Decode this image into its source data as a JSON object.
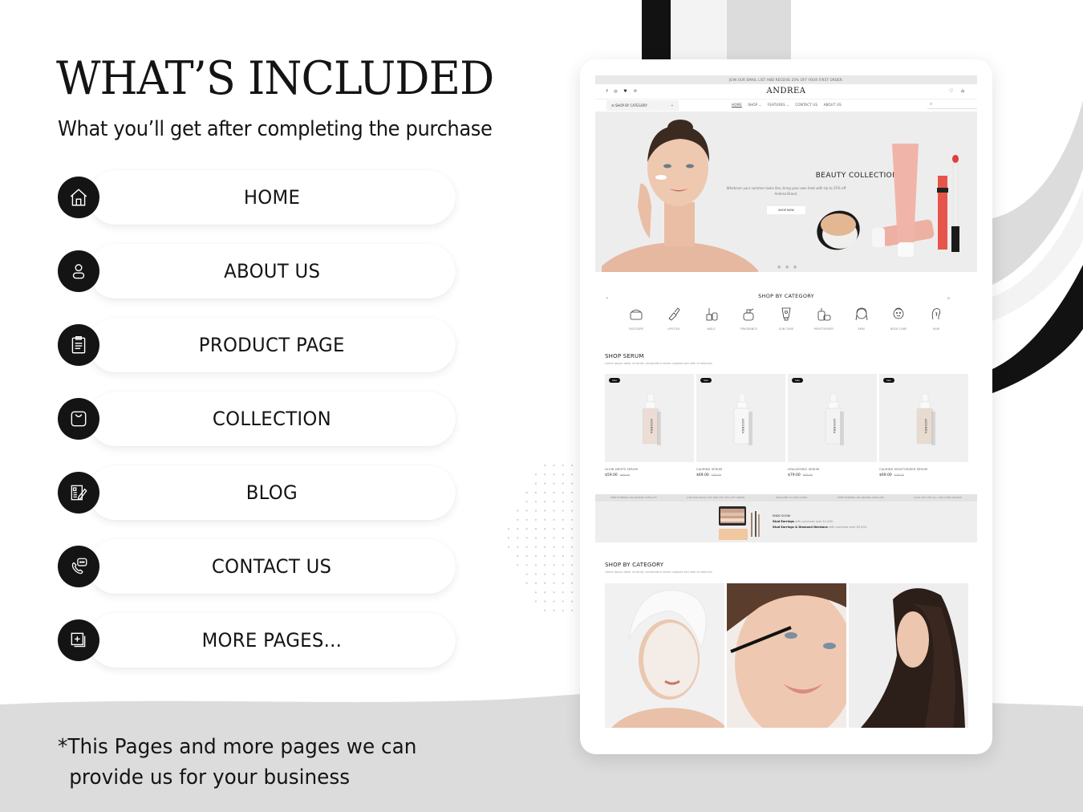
{
  "title": "WHAT’S INCLUDED",
  "subtitle": "What you’ll get after completing the purchase",
  "pages": [
    {
      "label": "HOME",
      "icon": "home-icon"
    },
    {
      "label": "ABOUT US",
      "icon": "user-icon"
    },
    {
      "label": "PRODUCT PAGE",
      "icon": "clipboard-icon"
    },
    {
      "label": "COLLECTION",
      "icon": "shopping-bag-icon"
    },
    {
      "label": "BLOG",
      "icon": "blog-edit-icon"
    },
    {
      "label": "CONTACT US",
      "icon": "phone-chat-icon"
    },
    {
      "label": "MORE PAGES...",
      "icon": "add-pages-icon"
    }
  ],
  "footnote": {
    "line1": "*This Pages and more pages we can",
    "line2": "provide us for your business"
  },
  "mockup": {
    "promo_bar": "JOIN OUR EMAIL LIST AND RECEIVE 20% OFF YOUR FIRST ORDER.",
    "brand": "ANDREA",
    "social_icons": "f ◎ ♥ ℗",
    "header_icons": "♡ ⌂",
    "category_button": "☰  SHOP BY CATEGORY",
    "category_chevron": "⌄",
    "nav_links": [
      "HOME",
      "SHOP ⌄",
      "FEATURES ⌄",
      "CONTACT US",
      "ABOUT US"
    ],
    "search_icon": "⌕",
    "hero": {
      "title": "BEAUTY COLLECTION",
      "description": "Whatever your summer looks like, bring your own heat with Up to 25% off Andrea Brand.",
      "button": "SHOP NOW",
      "slider_dots": "● ● ●"
    },
    "shop_by_category": {
      "title": "SHOP BY CATEGORY",
      "edge_left": "P",
      "edge_right": "M",
      "items": [
        "FACECARE",
        "LIPSTICK",
        "NAILS",
        "FRAGRANCE",
        "SUN CARE",
        "MOISTURIZER",
        "SKIN",
        "BODY CARE",
        "HAIR"
      ]
    },
    "shop_serum": {
      "title": "SHOP SERUM",
      "subtitle": "Lorem ipsum dolor sit amet, consectetur donec sodales sed nibh id vehicula.",
      "products": [
        {
          "badge": "Sale",
          "name": "GLOW DROPS SERUM",
          "price": "$59.00",
          "old_price": "$69.00",
          "tint": "#ecdcd6"
        },
        {
          "badge": "Sale",
          "name": "CALMING SERUM",
          "price": "$69.00",
          "old_price": "$79.00",
          "tint": "#f7f7f7"
        },
        {
          "badge": "Sale",
          "name": "HYALURONIC SERUM",
          "price": "$79.00",
          "old_price": "$89.00",
          "tint": "#f3f3f3"
        },
        {
          "badge": "Sale",
          "name": "CALMING MOISTURIZER SERUM",
          "price": "$69.00",
          "old_price": "$79.00",
          "tint": "#e8dcd0"
        }
      ]
    },
    "ticker": [
      "FREE SHIPPING ON ORDERS OVER £75",
      "JOIN OUR EMAIL LIST AND GET 20% OFF ORDER.",
      "WELCOME TO OUR STORE",
      "FREE SHIPPING ON ORDERS OVER £85",
      "SALE 25% OFF ALL, USE CODE ORANGE"
    ],
    "offer": {
      "heading": "ENDS SOON!",
      "line1_bold": "Stud Earrings",
      "line1_rest": " with purchase over $1,000.",
      "line2_bold": "Stud Earrings & Diamond Necklace",
      "line2_rest": " with purchase over $3,000."
    },
    "shop_by_category_2": {
      "title": "SHOP BY CATEGORY",
      "subtitle": "Lorem ipsum dolor sit amet, consectetur donec sodales sed nibh id vehicula."
    }
  },
  "colors": {
    "dark": "#141414",
    "light_gray": "#dcdcdc",
    "pale_gray": "#f3f3f3",
    "hero_bg": "#ededed"
  }
}
